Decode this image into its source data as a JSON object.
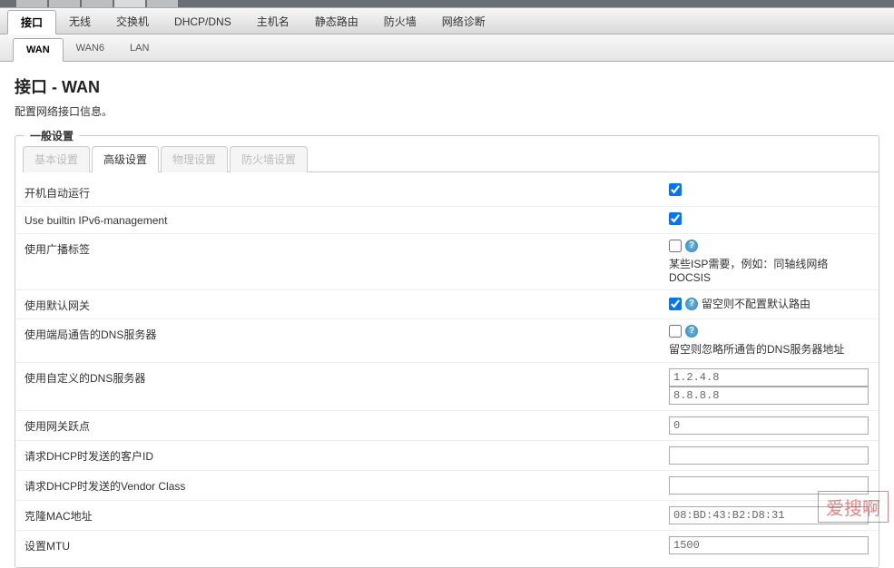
{
  "navbar": {
    "items": [
      {
        "label": "接口",
        "active": true
      },
      {
        "label": "无线"
      },
      {
        "label": "交换机"
      },
      {
        "label": "DHCP/DNS"
      },
      {
        "label": "主机名"
      },
      {
        "label": "静态路由"
      },
      {
        "label": "防火墙"
      },
      {
        "label": "网络诊断"
      }
    ]
  },
  "subbar": {
    "items": [
      {
        "label": "WAN",
        "active": true
      },
      {
        "label": "WAN6"
      },
      {
        "label": "LAN"
      }
    ]
  },
  "page": {
    "title": "接口 - WAN",
    "desc": "配置网络接口信息。"
  },
  "fieldset_legend": "一般设置",
  "inner_tabs": [
    {
      "label": "基本设置"
    },
    {
      "label": "高级设置",
      "active": true
    },
    {
      "label": "物理设置"
    },
    {
      "label": "防火墙设置"
    }
  ],
  "rows": {
    "autostart": {
      "label": "开机自动运行",
      "checked": true
    },
    "ipv6": {
      "label": "Use builtin IPv6-management",
      "checked": true
    },
    "broadcast": {
      "label": "使用广播标签",
      "checked": false,
      "help": "某些ISP需要，例如：同轴线网络DOCSIS"
    },
    "defgw": {
      "label": "使用默认网关",
      "checked": true,
      "help": "留空则不配置默认路由"
    },
    "peerdns": {
      "label": "使用端局通告的DNS服务器",
      "checked": false,
      "help": "留空则忽略所通告的DNS服务器地址"
    },
    "customdns": {
      "label": "使用自定义的DNS服务器",
      "values": [
        "1.2.4.8",
        "8.8.8.8"
      ]
    },
    "metric": {
      "label": "使用网关跃点",
      "value": "0"
    },
    "clientid": {
      "label": "请求DHCP时发送的客户ID",
      "value": ""
    },
    "vendorclass": {
      "label": "请求DHCP时发送的Vendor Class",
      "value": ""
    },
    "mac": {
      "label": "克隆MAC地址",
      "value": "08:BD:43:B2:D8:31"
    },
    "mtu": {
      "label": "设置MTU",
      "value": "1500"
    }
  },
  "watermark": "爱搜啊"
}
